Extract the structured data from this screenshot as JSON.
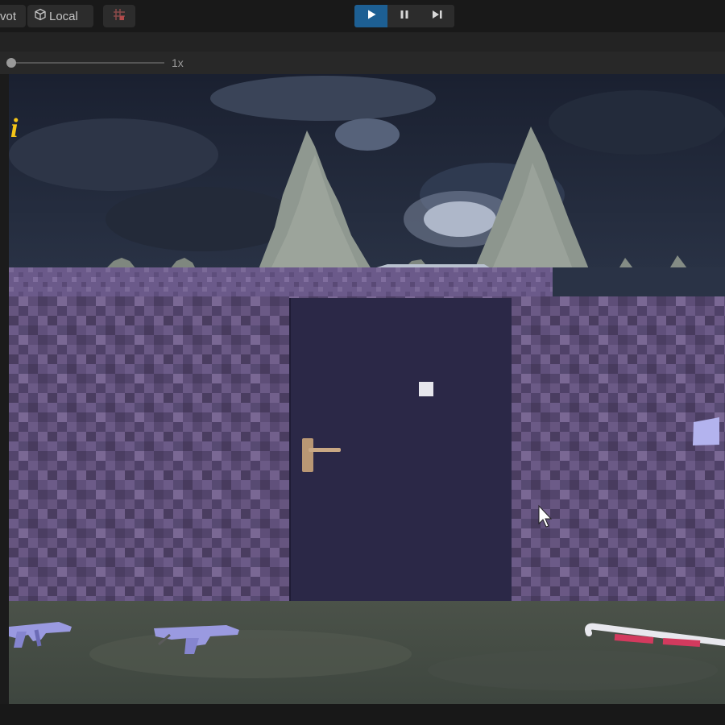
{
  "toolbar": {
    "pivot_label": "vot",
    "local_label": "Local",
    "icons": {
      "local": "cube-icon",
      "grid": "grid-snap-icon",
      "play": "play-icon",
      "pause": "pause-icon",
      "step": "step-icon"
    },
    "play_active": true
  },
  "game_view": {
    "scale_label": "1x",
    "scale_value": 1
  },
  "scene": {
    "hud_icon": "info-icon",
    "hud_text": "i",
    "objects": [
      "sky",
      "trees",
      "stone-wall",
      "door",
      "door-handle",
      "crosshair",
      "wall-note",
      "gun",
      "gun",
      "candy-cane-crowbar",
      "mouse-cursor"
    ]
  },
  "colors": {
    "accent_play": "#1d5f93",
    "door": "#2b2847",
    "wall": "#5a4a74",
    "hud_icon": "#f5c518",
    "sky": "#1e2433"
  }
}
